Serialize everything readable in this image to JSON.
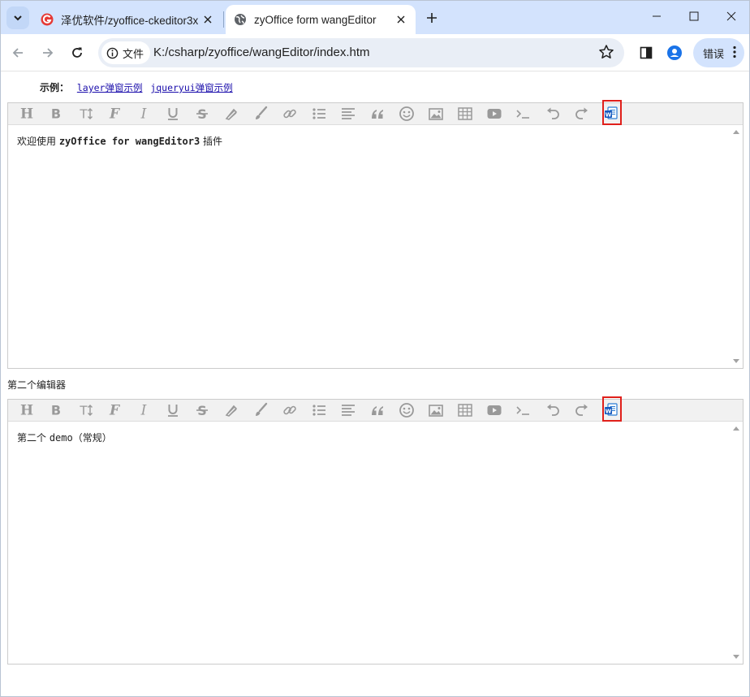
{
  "browser": {
    "tabs": [
      {
        "title": "泽优软件/zyoffice-ckeditor3x",
        "favicon": "zeyou-logo-icon",
        "active": false
      },
      {
        "title": "zyOffice form wangEditor",
        "favicon": "globe-icon",
        "active": true
      }
    ],
    "site_chip_label": "文件",
    "url": "K:/csharp/zyoffice/wangEditor/index.htm",
    "error_button_label": "错误"
  },
  "page": {
    "examples_label": "示例：",
    "links": [
      "layer弹窗示例",
      "jqueryui弹窗示例"
    ],
    "second_editor_label": "第二个编辑器",
    "editor1": {
      "content": {
        "prefix": "欢迎使用 ",
        "bold": "zyOffice for wangEditor3",
        "suffix": " 插件"
      }
    },
    "editor2": {
      "content": {
        "prefix": "第二个 ",
        "mono": "demo",
        "suffix": "（常规）"
      }
    },
    "toolbar_items": [
      "head",
      "bold",
      "font-size",
      "font-name",
      "italic",
      "underline",
      "strike-through",
      "fore-color",
      "back-color",
      "link",
      "list",
      "justify",
      "quote",
      "emoticon",
      "image",
      "table",
      "video",
      "code",
      "undo",
      "redo",
      "zyoffice-word-import"
    ],
    "colors": {
      "highlight_border": "#e0201b",
      "link": "#1a0dab",
      "tab_strip": "#d3e3fd",
      "tool_icon": "#999999"
    }
  }
}
